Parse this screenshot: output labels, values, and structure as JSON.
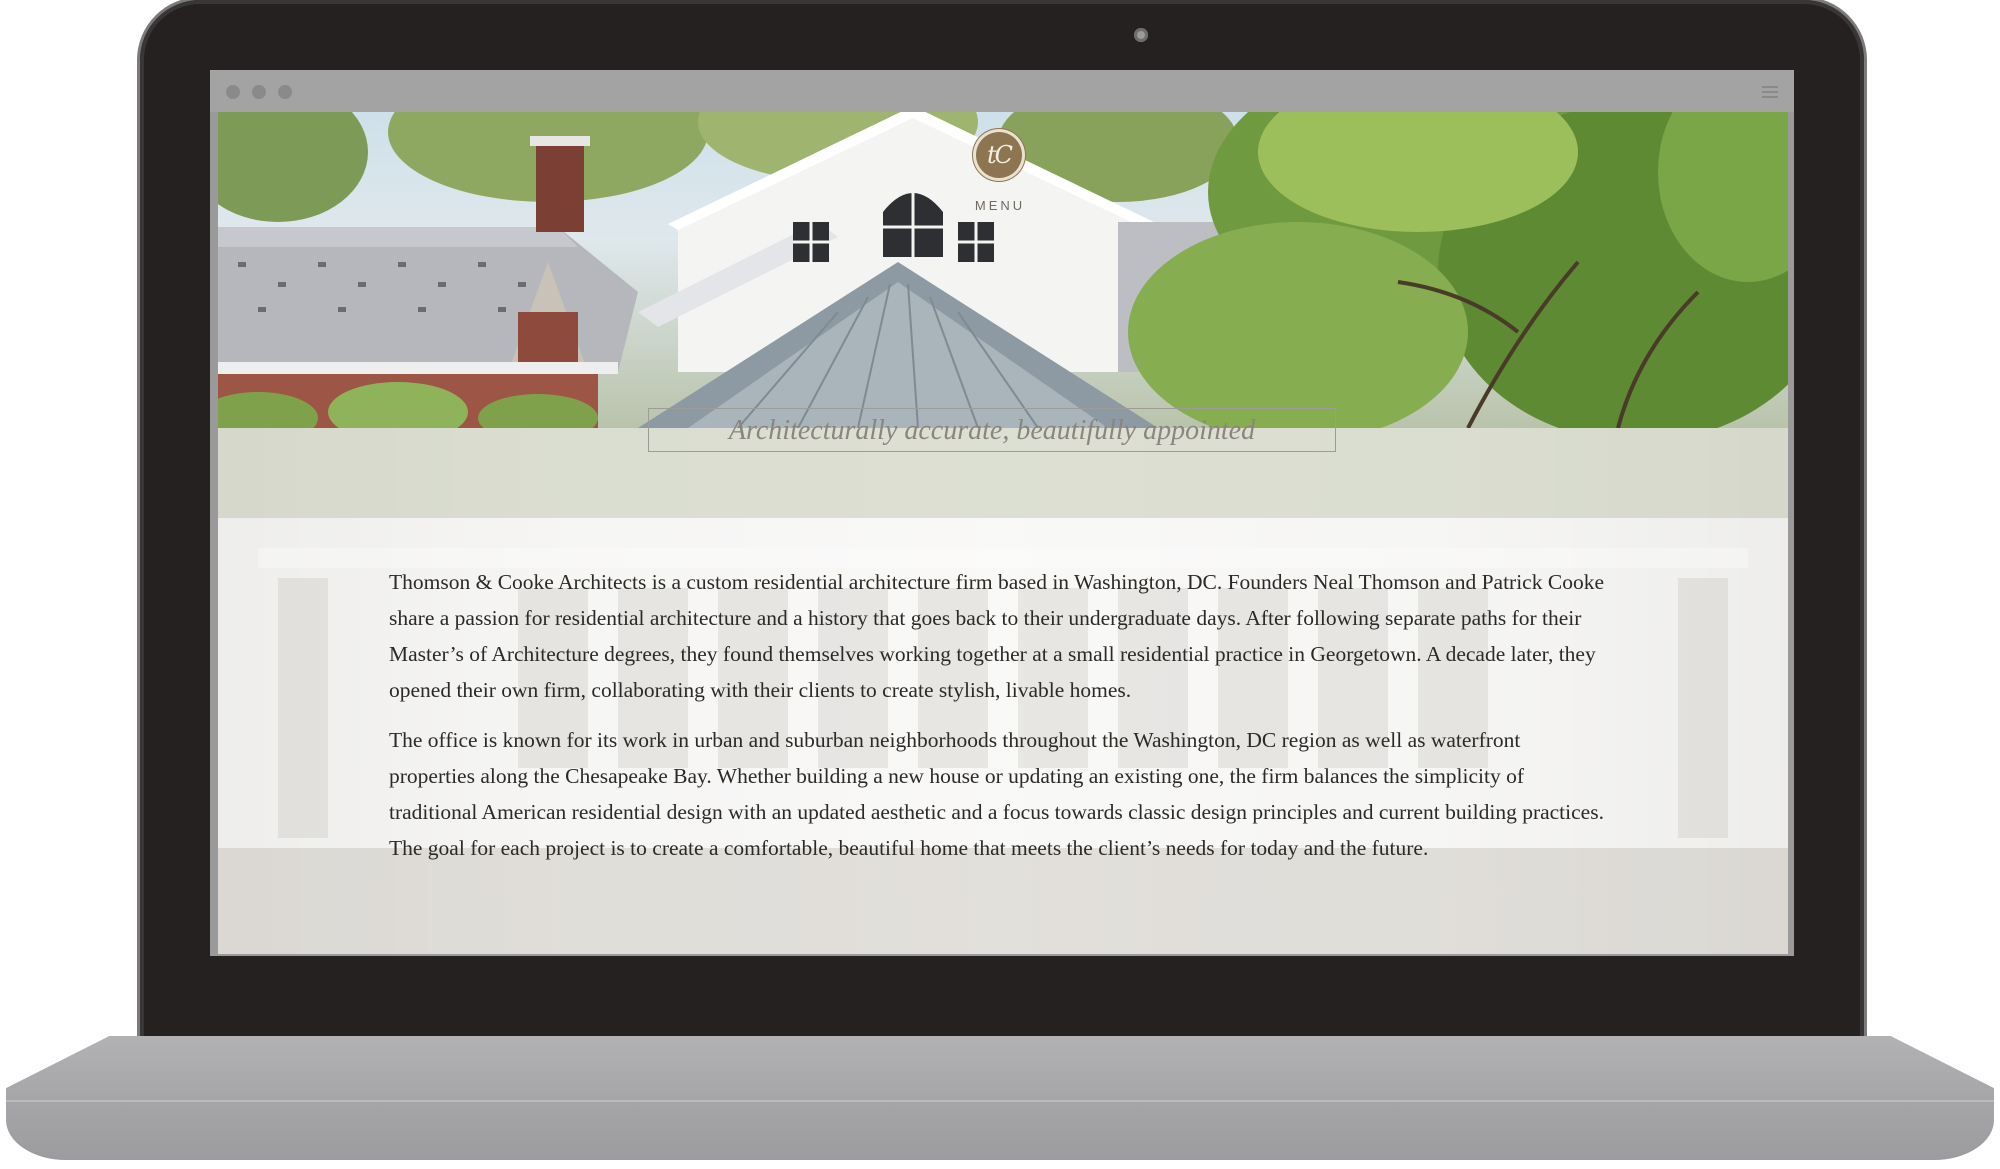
{
  "device": {
    "camera": "camera-dot"
  },
  "browser": {
    "window_controls": [
      "close",
      "minimize",
      "maximize"
    ],
    "menu_icon": "hamburger-icon"
  },
  "site": {
    "logo_text": "tC",
    "menu_label": "MENU",
    "tagline": "Architecturally accurate, beautifully appointed",
    "paragraphs": [
      "Thomson & Cooke Architects is a custom residential architecture firm based in Washington, DC. Founders Neal Thomson and Patrick Cooke share a passion for residential architecture and a history that goes back to their undergraduate days. After following separate paths for their Master’s of Architecture degrees, they found themselves working together at a small residential practice in Georgetown. A decade later, they opened their own firm, collaborating with their clients to create stylish, livable homes.",
      "The office is known for its work in urban and suburban neighborhoods throughout the Washington, DC region as well as waterfront properties along the Chesapeake Bay. Whether building a new house or updating an existing one, the firm balances the simplicity of traditional American residential design with an updated aesthetic and a focus towards classic design principles and current building practices. The goal for each project is to create a comfortable, beautiful home that meets the client’s needs for today and the future."
    ]
  },
  "colors": {
    "laptop_bezel": "#252121",
    "laptop_base": "#a7a7aa",
    "logo_gold": "#8e7552",
    "body_text": "#2c2a27"
  }
}
